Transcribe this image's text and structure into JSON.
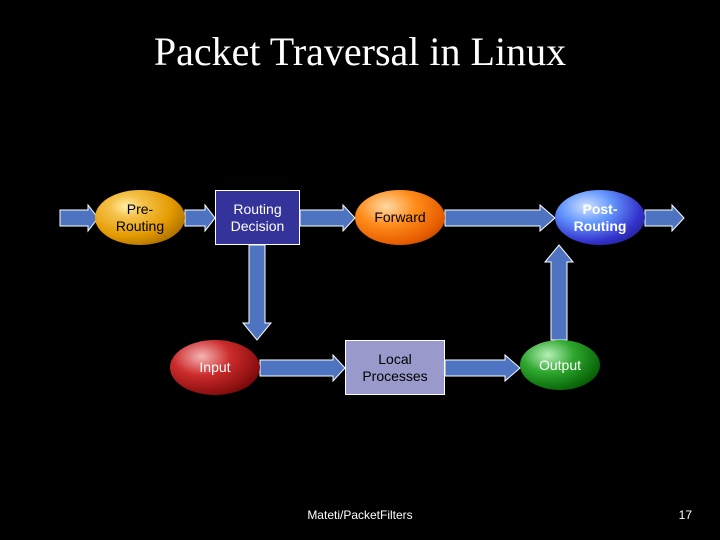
{
  "title": "Packet Traversal in Linux",
  "nodes": {
    "pre": "Pre-\nRouting",
    "rd": "Routing\nDecision",
    "fwd": "Forward",
    "post": "Post-\nRouting",
    "input": "Input",
    "local": "Local\nProcesses",
    "out": "Output"
  },
  "footer": "Mateti/PacketFilters",
  "page": "17",
  "edges": [
    {
      "from": "incoming",
      "to": "pre"
    },
    {
      "from": "pre",
      "to": "rd"
    },
    {
      "from": "rd",
      "to": "fwd"
    },
    {
      "from": "fwd",
      "to": "post"
    },
    {
      "from": "post",
      "to": "outgoing"
    },
    {
      "from": "rd",
      "to": "input"
    },
    {
      "from": "input",
      "to": "local"
    },
    {
      "from": "local",
      "to": "out"
    },
    {
      "from": "out",
      "to": "post"
    }
  ],
  "colors": {
    "background": "#000000",
    "title_text": "#ffffff",
    "rect_fill": "#333399",
    "local_fill": "#9999cc",
    "arrow_fill": "#4d73c1",
    "arrow_stroke": "#ffffff"
  }
}
